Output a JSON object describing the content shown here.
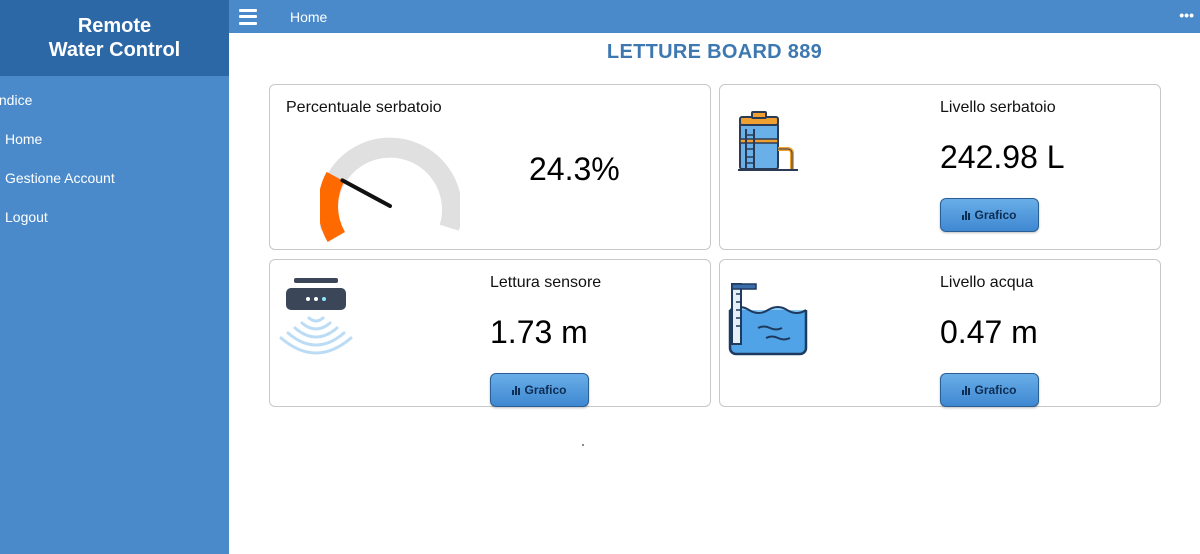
{
  "sidebar": {
    "brand_line1": "Remote",
    "brand_line2": "Water Control",
    "menu_title": "Indice",
    "items": [
      {
        "label": "Home"
      },
      {
        "label": "Gestione Account"
      },
      {
        "label": "Logout"
      }
    ]
  },
  "topbar": {
    "title": "Home",
    "menu_icon": "hamburger-icon",
    "more_icon": "more-dots-icon",
    "more_glyph": "•••"
  },
  "page": {
    "title": "LETTURE BOARD 889"
  },
  "cards": {
    "percent": {
      "title": "Percentuale serbatoio",
      "value": "24.3%",
      "gauge_level": 0.243,
      "gauge_fill_color": "#ff6a00",
      "gauge_track_color": "#e0e0e0"
    },
    "tank": {
      "title": "Livello serbatoio",
      "value": "242.98 L",
      "button_label": "Grafico",
      "icon": "water-tank-icon"
    },
    "sensor": {
      "title": "Lettura sensore",
      "value": "1.73 m",
      "button_label": "Grafico",
      "icon": "ultrasonic-sensor-icon"
    },
    "water": {
      "title": "Livello acqua",
      "value": "0.47 m",
      "button_label": "Grafico",
      "icon": "water-level-icon"
    }
  },
  "colors": {
    "sidebar": "#4a8acb",
    "sidebar_header": "#2c68a6",
    "title_blue": "#3d78b0",
    "button_blue": "#4f97dc"
  }
}
